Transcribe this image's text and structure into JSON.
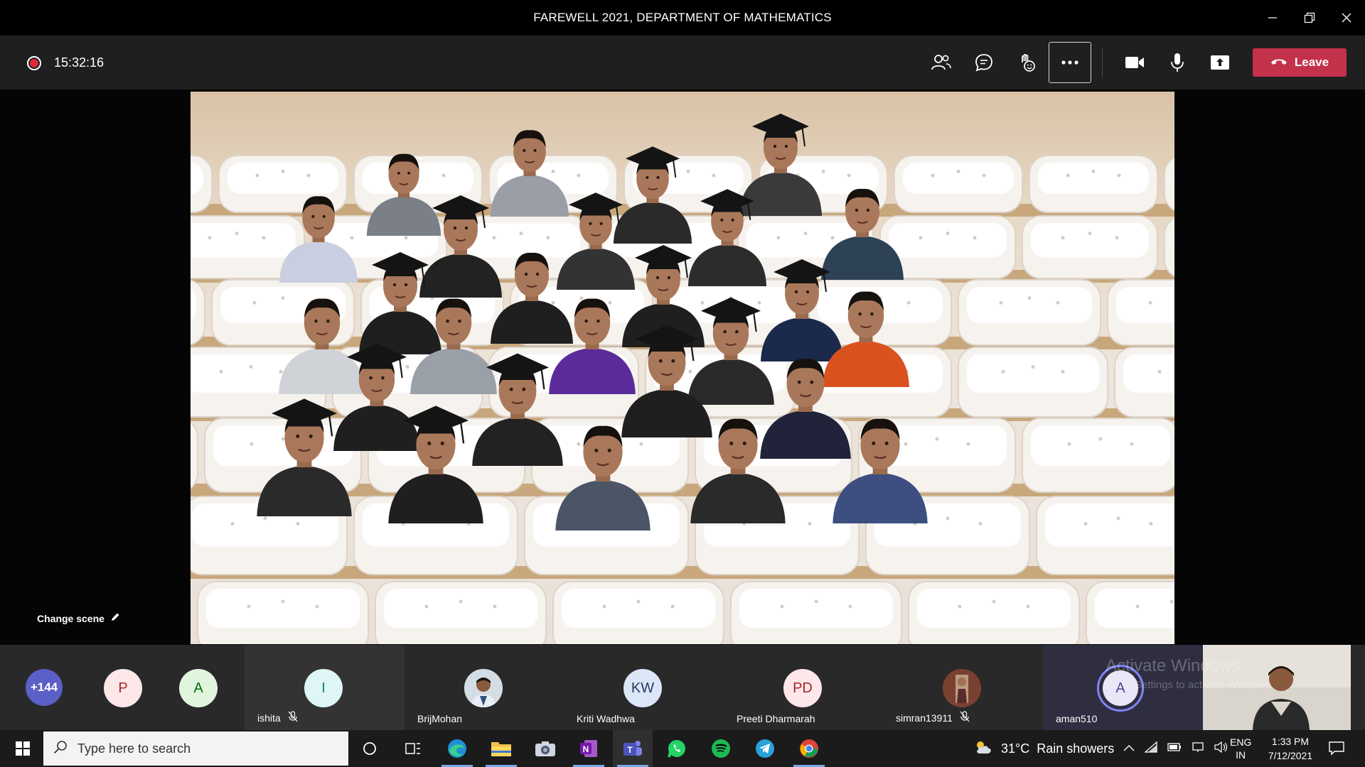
{
  "window": {
    "title": "FAREWELL 2021, DEPARTMENT OF MATHEMATICS",
    "controls": [
      "minimize-icon",
      "restore-icon",
      "close-icon"
    ]
  },
  "meeting_toolbar": {
    "recording_time": "15:32:16",
    "icons": [
      "participants-icon",
      "chat-icon",
      "reactions-icon",
      "more-icon",
      "camera-icon",
      "microphone-icon",
      "share-icon"
    ],
    "leave_label": "Leave",
    "leave_color": "#c4314b"
  },
  "stage": {
    "change_scene_label": "Change scene"
  },
  "participants": [
    {
      "id": "overflow",
      "initials": "+144",
      "color": "#5b5fc7"
    },
    {
      "id": "p",
      "initials": "P",
      "color": "#fde7e9"
    },
    {
      "id": "a1",
      "initials": "A",
      "color": "#dff6dd"
    },
    {
      "id": "ishita",
      "initials": "I",
      "name": "ishita",
      "muted": true,
      "color": "#e0f5f5"
    },
    {
      "id": "brijmohan",
      "name": "BrijMohan",
      "photo": true
    },
    {
      "id": "kriti",
      "initials": "KW",
      "name": "Kriti Wadhwa",
      "color": "#dbe7f7"
    },
    {
      "id": "preeti",
      "initials": "PD",
      "name": "Preeti Dharmarah",
      "color": "#fde7e9"
    },
    {
      "id": "simran",
      "name": "simran13911",
      "muted": true,
      "photo": true
    },
    {
      "id": "aman",
      "initials": "A",
      "name": "aman510",
      "color": "#e8e6f7",
      "speaking": true
    }
  ],
  "watermark": {
    "line1": "Activate Windows",
    "line2": "Go to Settings to activate Windows."
  },
  "taskbar": {
    "search_placeholder": "Type here to search",
    "apps": [
      "task-view-icon",
      "edge-icon",
      "file-explorer-icon",
      "camera-app-icon",
      "onenote-icon",
      "teams-icon",
      "whatsapp-icon",
      "spotify-icon",
      "telegram-icon",
      "chrome-icon"
    ],
    "weather_temp": "31°C",
    "weather_text": "Rain showers",
    "lang_top": "ENG",
    "lang_bottom": "IN",
    "time": "1:33 PM",
    "date": "7/12/2021"
  }
}
